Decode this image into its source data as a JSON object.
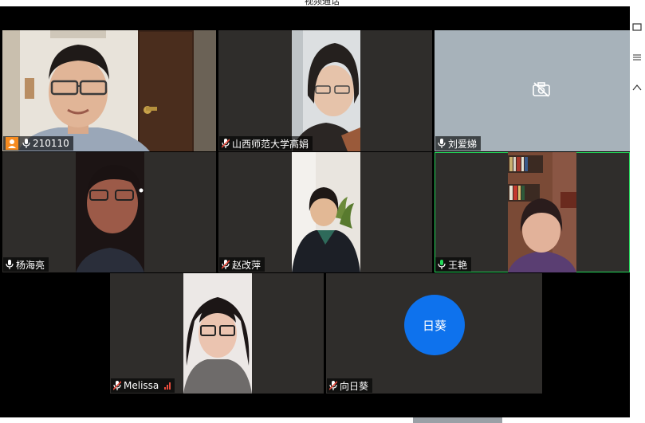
{
  "window": {
    "title": "视频通话"
  },
  "participants": [
    {
      "name": "210110",
      "host": true,
      "mic": "unmuted",
      "video": "on",
      "tile": "r1c1"
    },
    {
      "name": "山西师范大学高娟",
      "mic": "muted",
      "video": "on",
      "tile": "r1c2"
    },
    {
      "name": "刘爱娣",
      "mic": "unmuted",
      "video": "off",
      "tile": "r1c3"
    },
    {
      "name": "杨海亮",
      "mic": "unmuted",
      "video": "on",
      "tile": "r2c1"
    },
    {
      "name": "赵改萍",
      "mic": "muted",
      "video": "on",
      "tile": "r2c2"
    },
    {
      "name": "王艳",
      "mic": "speaking",
      "video": "on",
      "active_speaker": true,
      "tile": "r2c3"
    },
    {
      "name": "Melissa",
      "mic": "muted",
      "video": "on",
      "signal": "weak",
      "tile": "r3c1"
    },
    {
      "name": "向日葵",
      "mic": "muted",
      "video": "off",
      "avatar_text": "日葵",
      "tile": "r3c2"
    }
  ],
  "colors": {
    "active_speaker_border": "#23d959",
    "avatar_blue": "#0e72ed",
    "host_badge": "#f58a1f",
    "muted_mic": "#e84b3c",
    "tile_background": "#2f2d2b",
    "gallery_background": "#000000"
  },
  "icons": [
    "camera-off-icon",
    "microphone-icon",
    "microphone-muted-icon",
    "host-icon",
    "signal-strength-icon"
  ]
}
